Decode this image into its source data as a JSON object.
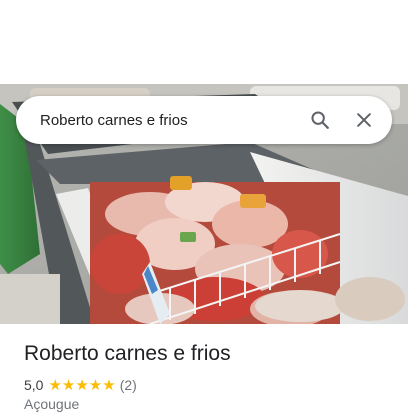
{
  "search": {
    "query": "Roberto carnes e frios",
    "search_icon": "search-icon",
    "close_icon": "close-icon"
  },
  "photo": {
    "subject": "place-photo"
  },
  "place": {
    "name": "Roberto carnes e frios",
    "rating": "5,0",
    "stars": "★★★★★",
    "rating_value": 5,
    "review_count": "(2)",
    "category": "Açougue"
  },
  "colors": {
    "star": "#fbbc04",
    "title": "#202124",
    "secondary_text": "#70757a"
  }
}
